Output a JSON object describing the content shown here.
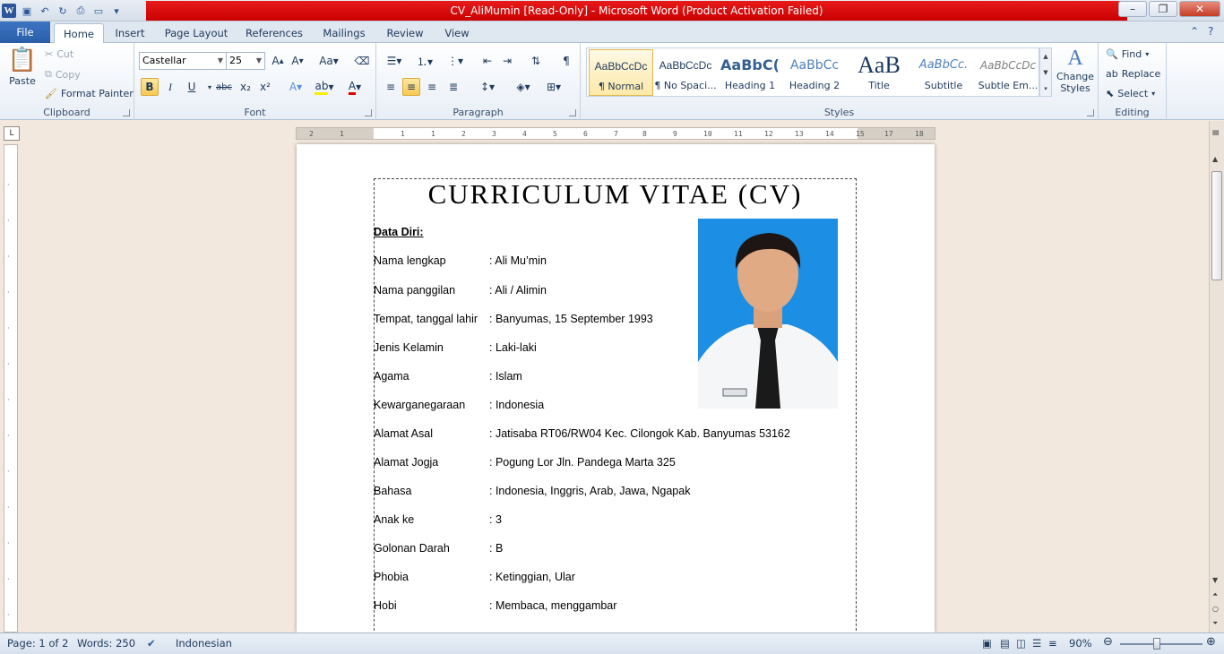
{
  "window": {
    "title": "CV_AliMumin [Read-Only]  -  Microsoft Word (Product Activation Failed)"
  },
  "tabs": [
    "File",
    "Home",
    "Insert",
    "Page Layout",
    "References",
    "Mailings",
    "Review",
    "View"
  ],
  "active_tab": "Home",
  "clipboard": {
    "paste": "Paste",
    "cut": "Cut",
    "copy": "Copy",
    "format_painter": "Format Painter",
    "label": "Clipboard"
  },
  "font": {
    "name": "Castellar",
    "size": "25",
    "label": "Font"
  },
  "paragraph": {
    "label": "Paragraph"
  },
  "styles": {
    "items": [
      {
        "preview": "AaBbCcDc",
        "name": "¶ Normal"
      },
      {
        "preview": "AaBbCcDc",
        "name": "¶ No Spaci..."
      },
      {
        "preview": "AaBbC(",
        "name": "Heading 1"
      },
      {
        "preview": "AaBbCc",
        "name": "Heading 2"
      },
      {
        "preview": "AaB",
        "name": "Title"
      },
      {
        "preview": "AaBbCc.",
        "name": "Subtitle"
      },
      {
        "preview": "AaBbCcDc",
        "name": "Subtle Em..."
      }
    ],
    "change_styles_1": "Change",
    "change_styles_2": "Styles",
    "label": "Styles"
  },
  "editing": {
    "find": "Find",
    "replace": "Replace",
    "select": "Select",
    "label": "Editing"
  },
  "document": {
    "title": "CURRICULUM VITAE (CV)",
    "section": "Data Diri:",
    "rows": [
      {
        "label": "Nama lengkap",
        "value": ":  Ali Mu’min"
      },
      {
        "label": "Nama panggilan",
        "value": ":  Ali / Alimin"
      },
      {
        "label": "Tempat, tanggal lahir",
        "value": ":  Banyumas, 15 September  1993"
      },
      {
        "label": "Jenis Kelamin",
        "value": ":  Laki-laki"
      },
      {
        "label": "Agama",
        "value": ":  Islam"
      },
      {
        "label": "Kewarganegaraan",
        "value": ": Indonesia"
      },
      {
        "label": "Alamat Asal",
        "value": ": Jatisaba RT06/RW04 Kec. Cilongok  Kab. Banyumas 53162"
      },
      {
        "label": "Alamat Jogja",
        "value": ": Pogung  Lor Jln. Pandega Marta 325"
      },
      {
        "label": "Bahasa",
        "value": ": Indonesia,  Inggris, Arab, Jawa, Ngapak"
      },
      {
        "label": "Anak ke",
        "value": ":  3"
      },
      {
        "label": "Golonan  Darah",
        "value": ":  B"
      },
      {
        "label": "Phobia",
        "value": ": Ketinggian,  Ular"
      },
      {
        "label": "Hobi",
        "value": ": Membaca,  menggambar"
      }
    ]
  },
  "status": {
    "page": "Page: 1 of 2",
    "words": "Words: 250",
    "language": "Indonesian",
    "zoom": "90%"
  },
  "ruler_ticks": [
    "2",
    "1",
    "1",
    "1",
    "2",
    "3",
    "4",
    "5",
    "6",
    "7",
    "8",
    "9",
    "10",
    "11",
    "12",
    "13",
    "14",
    "15",
    "17",
    "18"
  ]
}
